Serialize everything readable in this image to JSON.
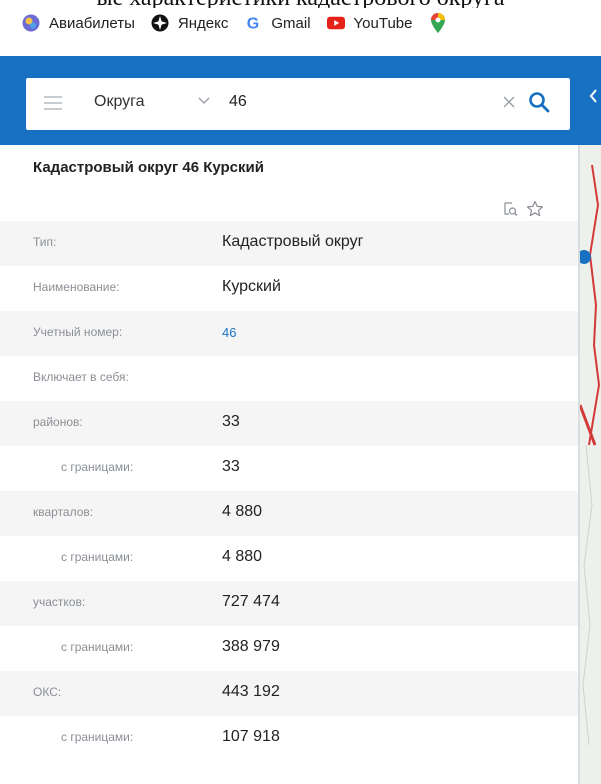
{
  "caption": "ые характеристики кадастрового округа",
  "bookmarks": [
    {
      "label": "Авиабилеты",
      "icon": "aviatickets-icon"
    },
    {
      "label": "Яндекс",
      "icon": "yandex-icon"
    },
    {
      "label": "Gmail",
      "icon": "google-icon"
    },
    {
      "label": "YouTube",
      "icon": "youtube-icon"
    }
  ],
  "search": {
    "scope": "Округа",
    "query": "46"
  },
  "panel": {
    "title": "Кадастровый округ 46 Курский",
    "rows": [
      {
        "label": "Тип:",
        "value": "Кадастровый округ"
      },
      {
        "label": "Наименование:",
        "value": "Курский"
      },
      {
        "label": "Учетный номер:",
        "value": "46"
      },
      {
        "label": "Включает в себя:",
        "value": ""
      },
      {
        "label": "районов:",
        "value": "33"
      },
      {
        "label": "с границами:",
        "value": "33"
      },
      {
        "label": "кварталов:",
        "value": "4 880"
      },
      {
        "label": "с границами:",
        "value": "4 880"
      },
      {
        "label": "участков:",
        "value": "727 474"
      },
      {
        "label": "с границами:",
        "value": "388 979"
      },
      {
        "label": "ОКС:",
        "value": "443 192"
      },
      {
        "label": "с границами:",
        "value": "107 918"
      }
    ]
  },
  "colors": {
    "header": "#1770c2",
    "link": "#1a73c4",
    "row_alt": "#f5f5f5"
  }
}
